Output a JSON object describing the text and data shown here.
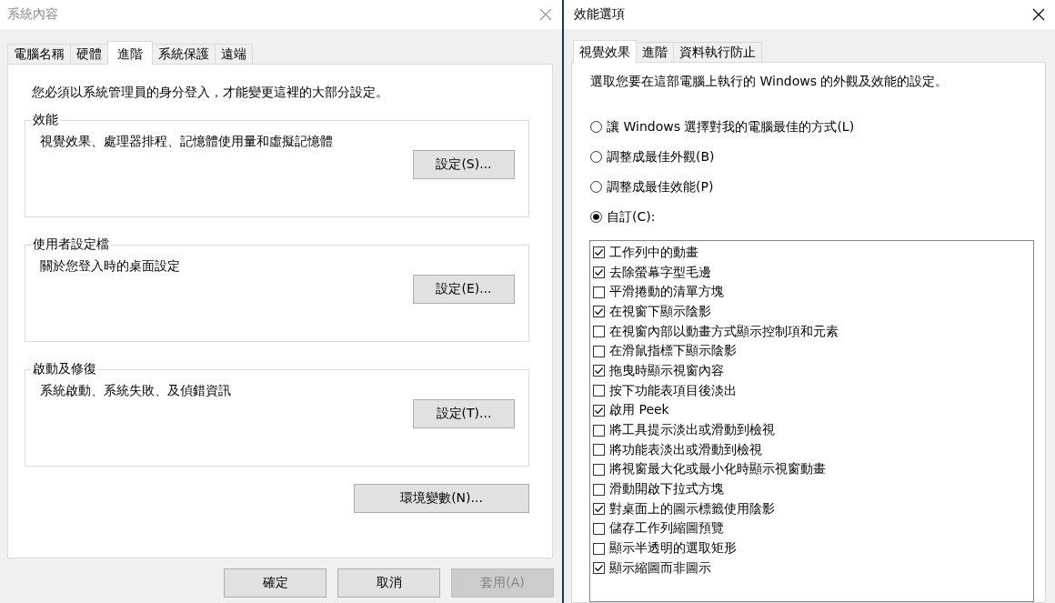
{
  "system_properties": {
    "title": "系統內容",
    "tabs": [
      {
        "label": "電腦名稱",
        "selected": false
      },
      {
        "label": "硬體",
        "selected": false
      },
      {
        "label": "進階",
        "selected": true
      },
      {
        "label": "系統保護",
        "selected": false
      },
      {
        "label": "遠端",
        "selected": false
      }
    ],
    "notice": "您必須以系統管理員的身分登入，才能變更這裡的大部分設定。",
    "groups": [
      {
        "title": "效能",
        "description": "視覺效果、處理器排程、記憶體使用量和虛擬記憶體",
        "button": "設定(S)..."
      },
      {
        "title": "使用者設定檔",
        "description": "關於您登入時的桌面設定",
        "button": "設定(E)..."
      },
      {
        "title": "啟動及修復",
        "description": "系統啟動、系統失敗、及偵錯資訊",
        "button": "設定(T)..."
      }
    ],
    "env_button": "環境變數(N)...",
    "buttons": [
      {
        "label": "確定",
        "disabled": false
      },
      {
        "label": "取消",
        "disabled": false
      },
      {
        "label": "套用(A)",
        "disabled": true
      }
    ]
  },
  "performance_options": {
    "title": "效能選項",
    "tabs": [
      {
        "label": "視覺效果",
        "selected": true
      },
      {
        "label": "進階",
        "selected": false
      },
      {
        "label": "資料執行防止",
        "selected": false
      }
    ],
    "description": "選取您要在這部電腦上執行的 Windows 的外觀及效能的設定。",
    "radios": [
      {
        "label": "讓 Windows 選擇對我的電腦最佳的方式(L)",
        "selected": false
      },
      {
        "label": "調整成最佳外觀(B)",
        "selected": false
      },
      {
        "label": "調整成最佳效能(P)",
        "selected": false
      },
      {
        "label": "自訂(C):",
        "selected": true
      }
    ],
    "checkboxes": [
      {
        "label": "工作列中的動畫",
        "checked": true
      },
      {
        "label": "去除螢幕字型毛邊",
        "checked": true
      },
      {
        "label": "平滑捲動的清單方塊",
        "checked": false
      },
      {
        "label": "在視窗下顯示陰影",
        "checked": true
      },
      {
        "label": "在視窗內部以動畫方式顯示控制項和元素",
        "checked": false
      },
      {
        "label": "在滑鼠指標下顯示陰影",
        "checked": false
      },
      {
        "label": "拖曳時顯示視窗內容",
        "checked": true
      },
      {
        "label": "按下功能表項目後淡出",
        "checked": false
      },
      {
        "label": "啟用 Peek",
        "checked": true
      },
      {
        "label": "將工具提示淡出或滑動到檢視",
        "checked": false
      },
      {
        "label": "將功能表淡出或滑動到檢視",
        "checked": false
      },
      {
        "label": "將視窗最大化或最小化時顯示視窗動畫",
        "checked": false
      },
      {
        "label": "滑動開啟下拉式方塊",
        "checked": false
      },
      {
        "label": "對桌面上的圖示標籤使用陰影",
        "checked": true
      },
      {
        "label": "儲存工作列縮圖預覽",
        "checked": false
      },
      {
        "label": "顯示半透明的選取矩形",
        "checked": false
      },
      {
        "label": "顯示縮圖而非圖示",
        "checked": true
      }
    ]
  }
}
